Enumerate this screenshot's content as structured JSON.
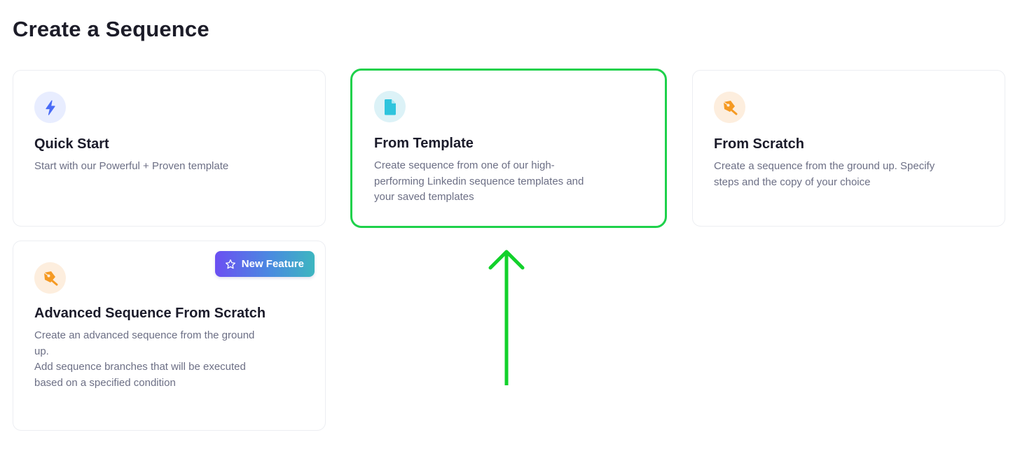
{
  "page": {
    "title": "Create a Sequence"
  },
  "cards": [
    {
      "title": "Quick Start",
      "description": "Start with our Powerful + Proven template",
      "icon": "bolt-icon"
    },
    {
      "title": "From Template",
      "description": "Create sequence from one of our high-\nperforming Linkedin sequence templates and\nyour saved templates",
      "icon": "document-icon"
    },
    {
      "title": "From Scratch",
      "description": "Create a sequence from the ground up. Specify\nsteps and the copy of your choice",
      "icon": "pen-tool-icon"
    },
    {
      "title": "Advanced Sequence From Scratch",
      "description": "Create an advanced sequence from the ground\nup.\nAdd sequence branches that will be executed\nbased on a specified condition",
      "icon": "pen-tool-icon",
      "badge": "New Feature"
    }
  ],
  "colors": {
    "highlight_border": "#1ed14b",
    "annotation_arrow": "#12d12b",
    "bolt_icon": "#4a6cf7",
    "document_icon": "#2ec4dd",
    "pen_icon": "#f59a23"
  }
}
